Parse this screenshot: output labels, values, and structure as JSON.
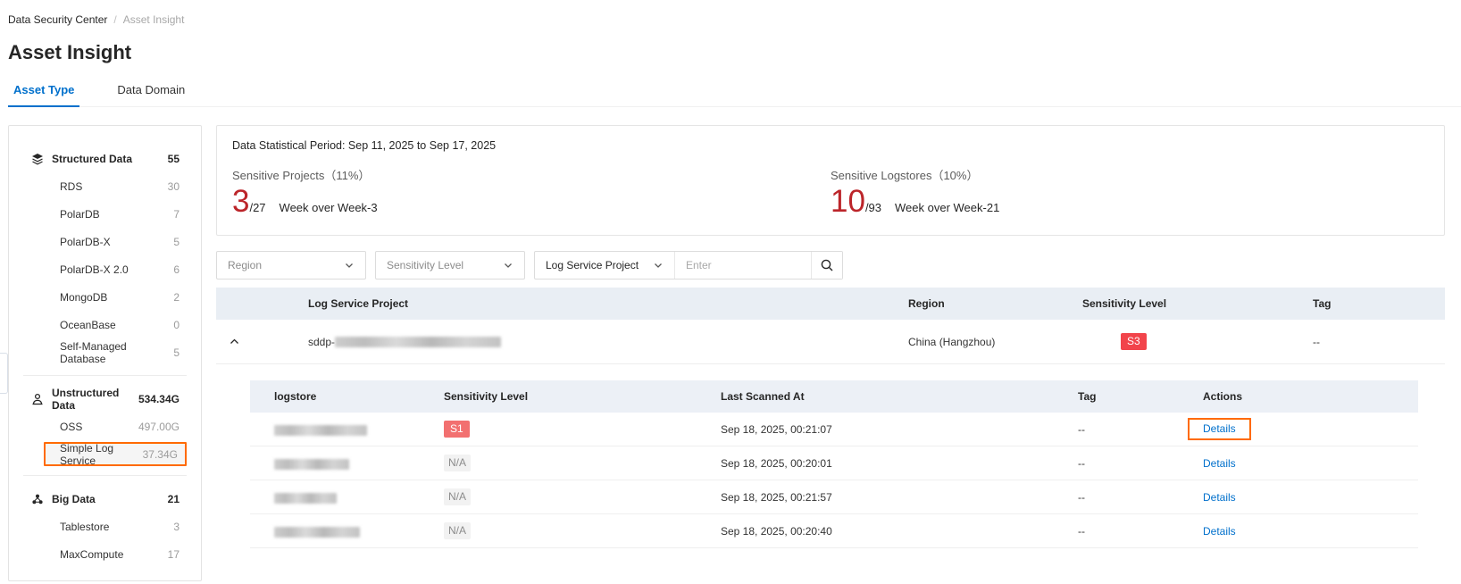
{
  "colors": {
    "accent_blue": "#0070cc",
    "accent_red": "#bc252a",
    "badge_s3_bg": "#f2444b",
    "badge_s1_bg": "#f27070",
    "badge_na_bg": "#f2f2f2",
    "highlight_orange": "#ff6a00",
    "table_header_bg": "#e9eef4"
  },
  "breadcrumb": {
    "root": "Data Security Center",
    "separator": "/",
    "current": "Asset Insight"
  },
  "page": {
    "title": "Asset Insight"
  },
  "tabs": [
    {
      "label": "Asset Type",
      "active": true
    },
    {
      "label": "Data Domain",
      "active": false
    }
  ],
  "sidebar": {
    "groups": [
      {
        "icon": "layers-icon",
        "label": "Structured Data",
        "count": "55",
        "children": [
          {
            "label": "RDS",
            "count": "30"
          },
          {
            "label": "PolarDB",
            "count": "7"
          },
          {
            "label": "PolarDB-X",
            "count": "5"
          },
          {
            "label": "PolarDB-X 2.0",
            "count": "6"
          },
          {
            "label": "MongoDB",
            "count": "2"
          },
          {
            "label": "OceanBase",
            "count": "0"
          },
          {
            "label": "Self-Managed Database",
            "count": "5"
          }
        ]
      },
      {
        "icon": "person-node-icon",
        "label": "Unstructured Data",
        "count": "534.34G",
        "children": [
          {
            "label": "OSS",
            "count": "497.00G"
          },
          {
            "label": "Simple Log Service",
            "count": "37.34G",
            "selected": true
          }
        ]
      },
      {
        "icon": "cluster-icon",
        "label": "Big Data",
        "count": "21",
        "children": [
          {
            "label": "Tablestore",
            "count": "3"
          },
          {
            "label": "MaxCompute",
            "count": "17"
          }
        ]
      }
    ]
  },
  "stats": {
    "period": "Data Statistical Period: Sep 11, 2025 to Sep 17, 2025",
    "cards": [
      {
        "label": "Sensitive Projects（11%）",
        "value": "3",
        "denominator": "/27",
        "note": "Week over Week-3"
      },
      {
        "label": "Sensitive Logstores（10%）",
        "value": "10",
        "denominator": "/93",
        "note": "Week over Week-21"
      }
    ]
  },
  "filters": {
    "region_label": "Region",
    "sensitivity_label": "Sensitivity Level",
    "project_label": "Log Service Project",
    "search_placeholder": "Enter"
  },
  "project_table": {
    "columns": [
      "Log Service Project",
      "Region",
      "Sensitivity Level",
      "Tag"
    ],
    "row": {
      "project_prefix": "sddp-",
      "project_redacted": true,
      "region": "China (Hangzhou)",
      "sensitivity": "S3",
      "tag": "--",
      "expanded": true
    }
  },
  "logstore_table": {
    "columns": [
      "logstore",
      "Sensitivity Level",
      "Last Scanned At",
      "Tag",
      "Actions"
    ],
    "rows": [
      {
        "logstore_redacted": true,
        "sensitivity": "S1",
        "scanned_at": "Sep 18, 2025, 00:21:07",
        "tag": "--",
        "action": "Details",
        "highlighted": true
      },
      {
        "logstore_redacted": true,
        "sensitivity": "N/A",
        "scanned_at": "Sep 18, 2025, 00:20:01",
        "tag": "--",
        "action": "Details",
        "highlighted": false
      },
      {
        "logstore_redacted": true,
        "sensitivity": "N/A",
        "scanned_at": "Sep 18, 2025, 00:21:57",
        "tag": "--",
        "action": "Details",
        "highlighted": false
      },
      {
        "logstore_redacted": true,
        "sensitivity": "N/A",
        "scanned_at": "Sep 18, 2025, 00:20:40",
        "tag": "--",
        "action": "Details",
        "highlighted": false
      }
    ]
  }
}
